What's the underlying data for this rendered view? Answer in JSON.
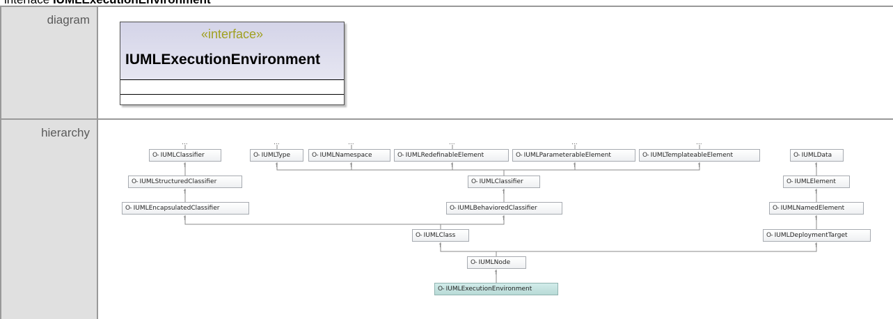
{
  "heading": {
    "prefix": "interface",
    "name": "IUMLExecutionEnvironment"
  },
  "rows": {
    "diagram_label": "diagram",
    "hierarchy_label": "hierarchy"
  },
  "interface_box": {
    "stereotype": "«interface»",
    "name": "IUMLExecutionEnvironment"
  },
  "icon_glyph": "O-",
  "ellipsis": "...",
  "nodes": {
    "uml_classifier_left": "IUMLClassifier",
    "uml_type": "IUMLType",
    "uml_namespace": "IUMLNamespace",
    "uml_redefinable": "IUMLRedefinableElement",
    "uml_parameterable": "IUMLParameterableElement",
    "uml_templateable": "IUMLTemplateableElement",
    "uml_data": "IUMLData",
    "uml_structured": "IUMLStructuredClassifier",
    "uml_classifier_mid": "IUMLClassifier",
    "uml_element": "IUMLElement",
    "uml_encapsulated": "IUMLEncapsulatedClassifier",
    "uml_behaviored": "IUMLBehavioredClassifier",
    "uml_named": "IUMLNamedElement",
    "uml_class": "IUMLClass",
    "uml_deployment": "IUMLDeploymentTarget",
    "uml_node": "IUMLNode",
    "uml_exec_env": "IUMLExecutionEnvironment"
  },
  "colors": {
    "selected_node": "#b8dad6",
    "label_cell": "#e0e0e0",
    "grid": "#999999",
    "stereotype": "#a0a020"
  }
}
